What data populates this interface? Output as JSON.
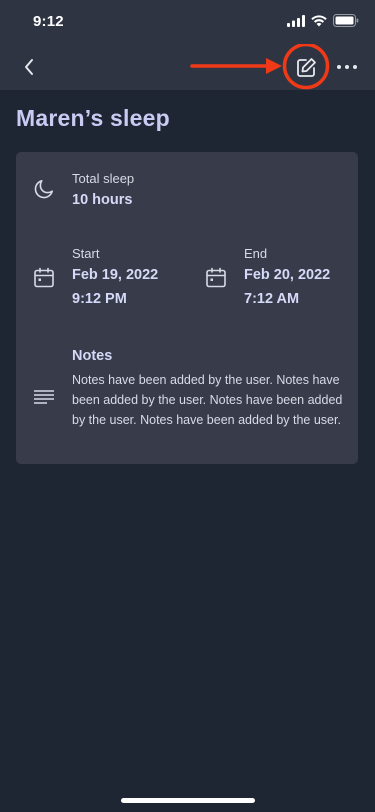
{
  "status_bar": {
    "time": "9:12"
  },
  "nav": {
    "back_icon": "chevron-left-icon",
    "edit_icon": "edit-icon",
    "more_icon": "more-icon",
    "highlight_color": "#f03a17"
  },
  "page": {
    "title": "Maren’s sleep"
  },
  "total_sleep": {
    "label": "Total sleep",
    "value": "10 hours"
  },
  "start": {
    "label": "Start",
    "date": "Feb 19, 2022",
    "time": "9:12 PM"
  },
  "end": {
    "label": "End",
    "date": "Feb 20, 2022",
    "time": "7:12 AM"
  },
  "notes": {
    "label": "Notes",
    "text": "Notes have been added by the user. Notes have been added by the user. Notes have been added by the user. Notes have been added by the user."
  },
  "colors": {
    "background": "#1f2633",
    "header": "#2e3441",
    "card": "#373b4a",
    "title": "#c9cbf3",
    "accent_text": "#d6d9f7"
  }
}
